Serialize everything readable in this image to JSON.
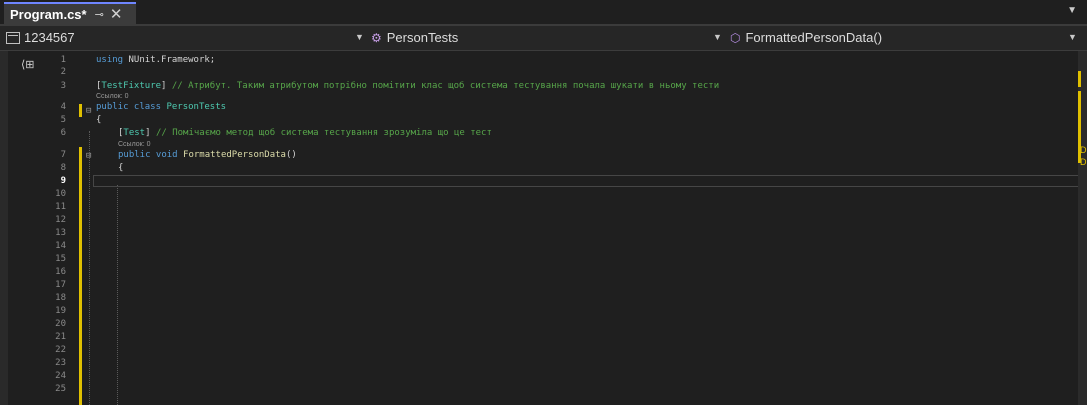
{
  "tab": {
    "title": "Program.cs*",
    "pin": "⊸",
    "close": "✕"
  },
  "tab_overflow": "▼",
  "nav": {
    "project": "1234567",
    "class_scope": "PersonTests",
    "member_scope": "FormattedPersonData()",
    "dropdown_glyph": "▼"
  },
  "editor": {
    "codelens": [
      "Ссылок: 0",
      "Ссылок: 0"
    ],
    "line_numbers": [
      "1",
      "2",
      "3",
      "4",
      "5",
      "6",
      "7",
      "8",
      "9",
      "10",
      "11",
      "12",
      "13",
      "14",
      "15",
      "16",
      "17",
      "18",
      "19",
      "20",
      "21",
      "22",
      "23",
      "24",
      "25"
    ],
    "active_line": "9",
    "lines": {
      "l1_kw": "using",
      "l1_ns": " NUnit.Framework;",
      "l3_attr_open": "[",
      "l3_attr": "TestFixture",
      "l3_attr_close": "]",
      "l3_comment": " // Атрибут. Таким атрибутом потрібно помітити клас щоб система тестування почала шукати в ньому тести",
      "l4_kw": "public class",
      "l4_type": " PersonTests",
      "l5_brace": "{",
      "l6_attr_open": "[",
      "l6_attr": "Test",
      "l6_attr_close": "]",
      "l6_comment": " // Помічаємо метод щоб система тестування зрозуміла що це тест",
      "l7_kw": "public void",
      "l7_method": " FormattedPersonData",
      "l7_parens": "()",
      "l8_brace": "{"
    }
  },
  "colors": {
    "keyword": "#569cd6",
    "type": "#4ec9b0",
    "comment": "#57a64a",
    "method": "#dcdcaa",
    "change_marker": "#e0c000",
    "tab_accent": "#6f86ff"
  }
}
